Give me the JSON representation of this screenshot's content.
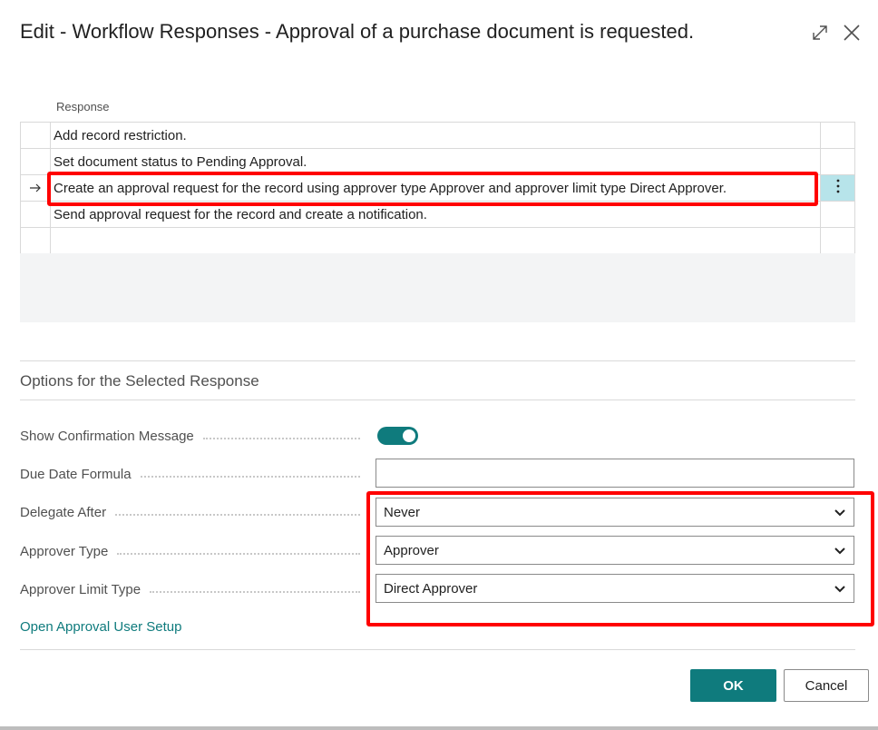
{
  "dialog": {
    "title": "Edit - Workflow Responses - Approval of a purchase document is requested."
  },
  "icons": {
    "expand": "expand-icon",
    "close": "close-icon",
    "row_arrow": "arrow-right-icon",
    "row_menu": "vertical-ellipsis-icon",
    "dropdown": "chevron-down-icon"
  },
  "responses": {
    "column_header": "Response",
    "rows": [
      {
        "text": "Add record restriction."
      },
      {
        "text": "Set document status to Pending Approval."
      },
      {
        "text": "Create an approval request for the record using approver type Approver and approver limit type Direct Approver.",
        "selected": true
      },
      {
        "text": "Send approval request for the record and create a notification."
      },
      {
        "text": ""
      }
    ]
  },
  "options": {
    "section_title": "Options for the Selected Response",
    "show_confirmation": {
      "label": "Show Confirmation Message",
      "value": true
    },
    "due_date_formula": {
      "label": "Due Date Formula",
      "value": ""
    },
    "delegate_after": {
      "label": "Delegate After",
      "value": "Never"
    },
    "approver_type": {
      "label": "Approver Type",
      "value": "Approver"
    },
    "approver_limit_type": {
      "label": "Approver Limit Type",
      "value": "Direct Approver"
    },
    "link": "Open Approval User Setup"
  },
  "footer": {
    "ok": "OK",
    "cancel": "Cancel"
  },
  "colors": {
    "accent": "#0f7b7d",
    "highlight": "#ff0000",
    "selected_row_action": "#b7e4ea"
  }
}
